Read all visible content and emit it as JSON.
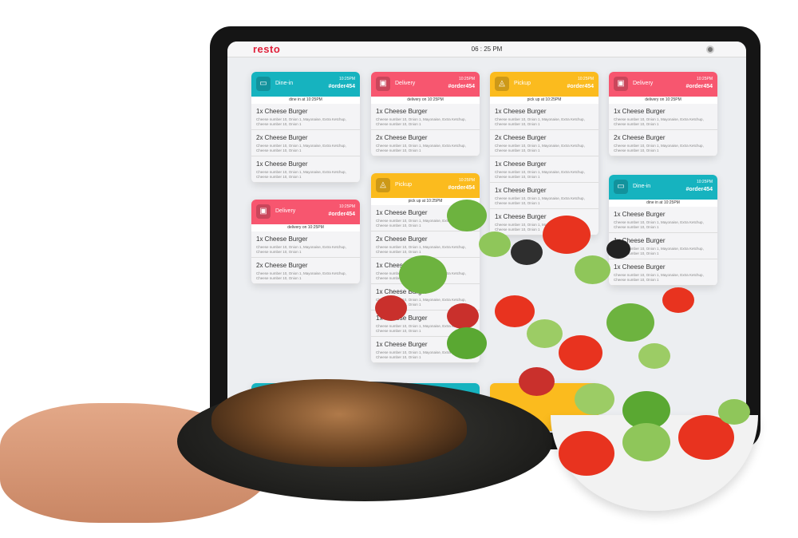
{
  "header": {
    "logo": "resto",
    "clock": "06 : 25 PM"
  },
  "cards": [
    {
      "type": "Dine-in",
      "time": "10:25PM",
      "order": "#order454",
      "sub": "dine in at 10:25PM",
      "items": [
        {
          "name": "1x  Cheese Burger",
          "desc": "Cheese number 10, Onion 1, Mayonaise, Extra Ketchup, Cheese number 10, Onion 1"
        },
        {
          "name": "2x  Cheese Burger",
          "desc": "Cheese number 10, Onion 1, Mayonaise, Extra Ketchup, Cheese number 10, Onion 1"
        },
        {
          "name": "1x  Cheese Burger",
          "desc": "Cheese number 10, Onion 1, Mayonaise, Extra Ketchup, Cheese number 10, Onion 1"
        }
      ]
    },
    {
      "type": "Delivery",
      "time": "10:25PM",
      "order": "#order454",
      "sub": "delivery on 10:25PM",
      "items": [
        {
          "name": "1x  Cheese Burger",
          "desc": "Cheese number 10, Onion 1, Mayonaise, Extra Ketchup, Cheese number 10, Onion 1"
        },
        {
          "name": "2x  Cheese Burger",
          "desc": "Cheese number 10, Onion 1, Mayonaise, Extra Ketchup, Cheese number 10, Onion 1"
        }
      ]
    },
    {
      "type": "Pickup",
      "time": "10:25PM",
      "order": "#order454",
      "sub": "pick up at 10:25PM",
      "items": [
        {
          "name": "1x  Cheese Burger",
          "desc": "Cheese number 10, Onion 1, Mayonaise, Extra Ketchup, Cheese number 10, Onion 1"
        },
        {
          "name": "2x  Cheese Burger",
          "desc": "Cheese number 10, Onion 1, Mayonaise, Extra Ketchup, Cheese number 10, Onion 1"
        },
        {
          "name": "1x  Cheese Burger",
          "desc": "Cheese number 10, Onion 1, Mayonaise, Extra Ketchup, Cheese number 10, Onion 1"
        },
        {
          "name": "1x  Cheese Burger",
          "desc": "Cheese number 10, Onion 1, Mayonaise, Extra Ketchup, Cheese number 10, Onion 1"
        },
        {
          "name": "1x  Cheese Burger",
          "desc": "Cheese number 10, Onion 1, Mayonaise, Extra Ketchup, Cheese number 10, Onion 1"
        }
      ]
    },
    {
      "type": "Delivery",
      "time": "10:25PM",
      "order": "#order454",
      "sub": "delivery on 10:25PM",
      "items": [
        {
          "name": "1x  Cheese Burger",
          "desc": "Cheese number 10, Onion 1, Mayonaise, Extra Ketchup, Cheese number 10, Onion 1"
        },
        {
          "name": "2x  Cheese Burger",
          "desc": "Cheese number 10, Onion 1, Mayonaise, Extra Ketchup, Cheese number 10, Onion 1"
        }
      ]
    },
    {
      "type": "Delivery",
      "time": "10:25PM",
      "order": "#order454",
      "sub": "delivery on 10:25PM",
      "items": [
        {
          "name": "1x  Cheese Burger",
          "desc": "Cheese number 10, Onion 1, Mayonaise, Extra Ketchup, Cheese number 10, Onion 1"
        },
        {
          "name": "2x  Cheese Burger",
          "desc": "Cheese number 10, Onion 1, Mayonaise, Extra Ketchup, Cheese number 10, Onion 1"
        }
      ]
    },
    {
      "type": "Pickup",
      "time": "10:25PM",
      "order": "#order454",
      "sub": "pick up at 10:25PM",
      "items": [
        {
          "name": "1x  Cheese Burger",
          "desc": "Cheese number 10, Onion 1, Mayonaise, Extra Ketchup, Cheese number 10, Onion 1"
        },
        {
          "name": "2x  Cheese Burger",
          "desc": "Cheese number 10, Onion 1, Mayonaise, Extra Ketchup, Cheese number 10, Onion 1"
        },
        {
          "name": "1x  Cheese Burger",
          "desc": "Cheese number 10, Onion 1, Mayonaise, Extra Ketchup, Cheese number 10, Onion 1"
        },
        {
          "name": "1x  Cheese Burger",
          "desc": "Cheese number 10, Onion 1, Mayonaise, Extra Ketchup, Cheese number 10, Onion 1"
        },
        {
          "name": "1x  Cheese Burger",
          "desc": "Cheese number 10, Onion 1, Mayonaise, Extra Ketchup, Cheese number 10, Onion 1"
        },
        {
          "name": "1x  Cheese Burger",
          "desc": "Cheese number 10, Onion 1, Mayonaise, Extra Ketchup, Cheese number 10, Onion 1"
        }
      ]
    },
    {
      "type": "Dine-in",
      "time": "10:25PM",
      "order": "#order454",
      "sub": "dine in at 10:25PM",
      "items": [
        {
          "name": "1x  Cheese Burger",
          "desc": "Cheese number 10, Onion 1, Mayonaise, Extra Ketchup, Cheese number 10, Onion 1"
        },
        {
          "name": "1x  Cheese Burger",
          "desc": "Cheese number 10, Onion 1, Mayonaise, Extra Ketchup, Cheese number 10, Onion 1"
        },
        {
          "name": "1x  Cheese Burger",
          "desc": "Cheese number 10, Onion 1, Mayonaise, Extra Ketchup, Cheese number 10, Onion 1"
        }
      ]
    }
  ],
  "colors": {
    "dine_in": "#16b3bf",
    "delivery": "#f7566f",
    "pickup": "#fbbb1e",
    "brand": "#e0203a"
  }
}
